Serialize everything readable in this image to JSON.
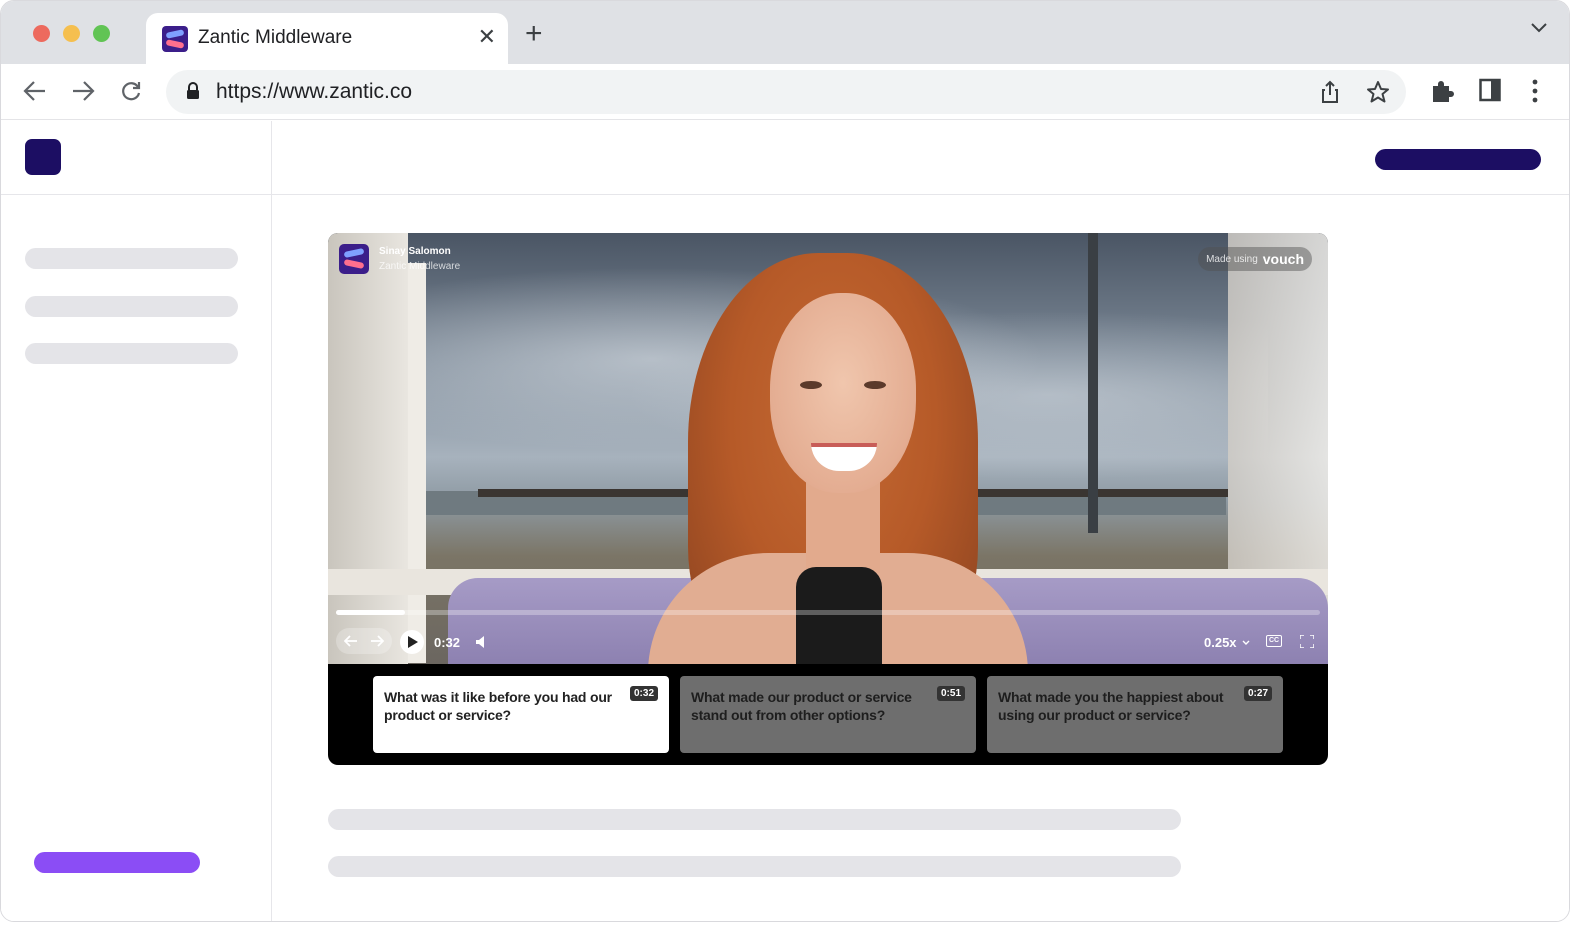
{
  "browser": {
    "tab_title": "Zantic Middleware",
    "tab_close": "✕",
    "new_tab": "+",
    "url": "https://www.zantic.co",
    "icons": [
      "back-icon",
      "forward-icon",
      "reload-icon",
      "lock-icon",
      "share-icon",
      "star-icon",
      "extensions-icon",
      "sidepanel-icon",
      "more-icon",
      "tab-menu-icon"
    ]
  },
  "video": {
    "presenter_name": "Sinay Salomon",
    "presenter_company": "Zantic Middleware",
    "badge_prefix": "Made using",
    "badge_brand": "vouch",
    "current_time": "0:32",
    "progress_fraction": 0.07,
    "speed": "0.25x",
    "cc_label": "CC"
  },
  "questions": [
    {
      "text": "What was it like before you had our product or service?",
      "duration": "0:32",
      "active": true
    },
    {
      "text": "What made our product or service stand out from other options?",
      "duration": "0:51",
      "active": false
    },
    {
      "text": "What made you the happiest about using our product or service?",
      "duration": "0:27",
      "active": false
    }
  ],
  "colors": {
    "brand_navy": "#1c0e63",
    "accent_purple": "#8b4df5",
    "skeleton": "#e4e4e8"
  }
}
